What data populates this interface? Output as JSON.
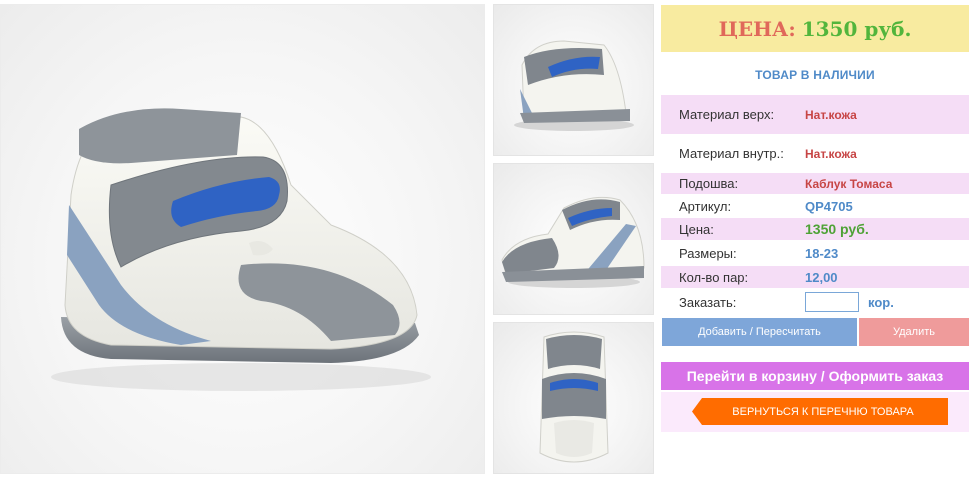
{
  "product": {
    "price_label": "ЦЕНА:",
    "price_value": "1350 руб.",
    "stock_status": "ТОВАР В НАЛИЧИИ"
  },
  "properties": [
    {
      "name": "Материал верх:",
      "value": "Нат.кожа"
    },
    {
      "name": "Материал внутр.:",
      "value": "Нат.кожа"
    },
    {
      "name": "Подошва:",
      "value": "Каблук Томаса"
    },
    {
      "name": "Артикул:",
      "value": "QP4705"
    },
    {
      "name": "Цена:",
      "value": "1350 руб."
    },
    {
      "name": "Размеры:",
      "value": "18-23"
    },
    {
      "name": "Кол-во пар:",
      "value": "12,00"
    }
  ],
  "order": {
    "label": "Заказать:",
    "quantity_value": "",
    "unit": "кор."
  },
  "buttons": {
    "add_recalc": "Добавить / Пересчитать",
    "delete": "Удалить",
    "go_to_cart": "Перейти в корзину / Оформить заказ",
    "back_to_list": "ВЕРНУТЬСЯ К ПЕРЕЧНЮ ТОВАРА"
  },
  "colors": {
    "price_box_bg": "#f8eba0",
    "price_label": "#e0685a",
    "price_value": "#52b53c",
    "stock_text": "#4f8ac8",
    "row_pink": "#f5ddf6",
    "add_button": "#7ea6d9",
    "delete_button": "#ef9b9b",
    "cart_button": "#d873e8",
    "back_button": "#ff6c00"
  },
  "images": {
    "main": "shoe-photo-side-view",
    "thumbs": [
      "shoe-thumb-back-view",
      "shoe-thumb-side-view",
      "shoe-thumb-top-view"
    ]
  }
}
